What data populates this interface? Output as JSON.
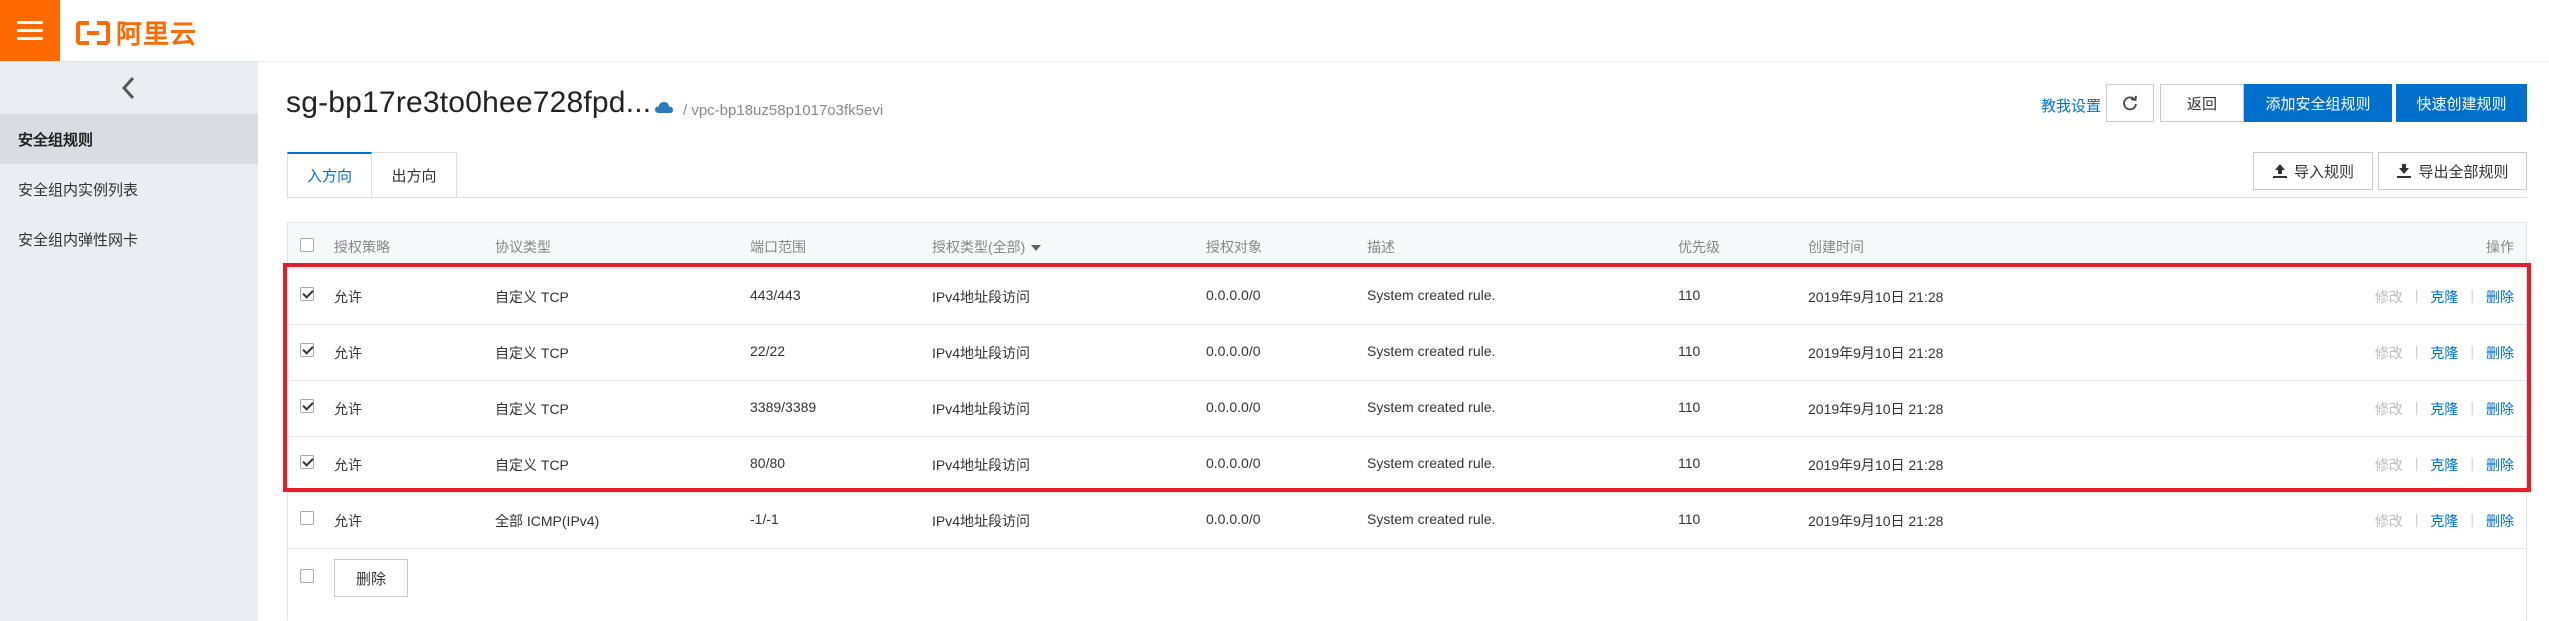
{
  "brand": {
    "logo_text": "阿里云",
    "accent": "#ff6a00"
  },
  "sidebar": {
    "items": [
      {
        "label": "安全组规则",
        "active": true
      },
      {
        "label": "安全组内实例列表",
        "active": false
      },
      {
        "label": "安全组内弹性网卡",
        "active": false
      }
    ]
  },
  "header": {
    "title": "sg-bp17re3to0hee728fpd...",
    "vpc": "/ vpc-bp18uz58p1017o3fk5evi",
    "help": "教我设置",
    "back": "返回",
    "add_rule": "添加安全组规则",
    "quick_create": "快速创建规则"
  },
  "tabs": [
    {
      "label": "入方向",
      "active": true
    },
    {
      "label": "出方向",
      "active": false
    }
  ],
  "toolbar": {
    "import": "导入规则",
    "export": "导出全部规则"
  },
  "table": {
    "columns": {
      "policy": "授权策略",
      "protocol": "协议类型",
      "port": "端口范围",
      "auth_type": "授权类型(全部)",
      "auth_object": "授权对象",
      "desc": "描述",
      "priority": "优先级",
      "created": "创建时间",
      "actions": "操作"
    },
    "rows": [
      {
        "checked": true,
        "policy": "允许",
        "protocol": "自定义 TCP",
        "port": "443/443",
        "auth_type": "IPv4地址段访问",
        "auth_object": "0.0.0.0/0",
        "desc": "System created rule.",
        "priority": "110",
        "created": "2019年9月10日 21:28"
      },
      {
        "checked": true,
        "policy": "允许",
        "protocol": "自定义 TCP",
        "port": "22/22",
        "auth_type": "IPv4地址段访问",
        "auth_object": "0.0.0.0/0",
        "desc": "System created rule.",
        "priority": "110",
        "created": "2019年9月10日 21:28"
      },
      {
        "checked": true,
        "policy": "允许",
        "protocol": "自定义 TCP",
        "port": "3389/3389",
        "auth_type": "IPv4地址段访问",
        "auth_object": "0.0.0.0/0",
        "desc": "System created rule.",
        "priority": "110",
        "created": "2019年9月10日 21:28"
      },
      {
        "checked": true,
        "policy": "允许",
        "protocol": "自定义 TCP",
        "port": "80/80",
        "auth_type": "IPv4地址段访问",
        "auth_object": "0.0.0.0/0",
        "desc": "System created rule.",
        "priority": "110",
        "created": "2019年9月10日 21:28"
      },
      {
        "checked": false,
        "policy": "允许",
        "protocol": "全部 ICMP(IPv4)",
        "port": "-1/-1",
        "auth_type": "IPv4地址段访问",
        "auth_object": "0.0.0.0/0",
        "desc": "System created rule.",
        "priority": "110",
        "created": "2019年9月10日 21:28"
      }
    ],
    "actions": {
      "edit": "修改",
      "clone": "克隆",
      "delete": "删除"
    },
    "bulk_delete": "删除"
  }
}
